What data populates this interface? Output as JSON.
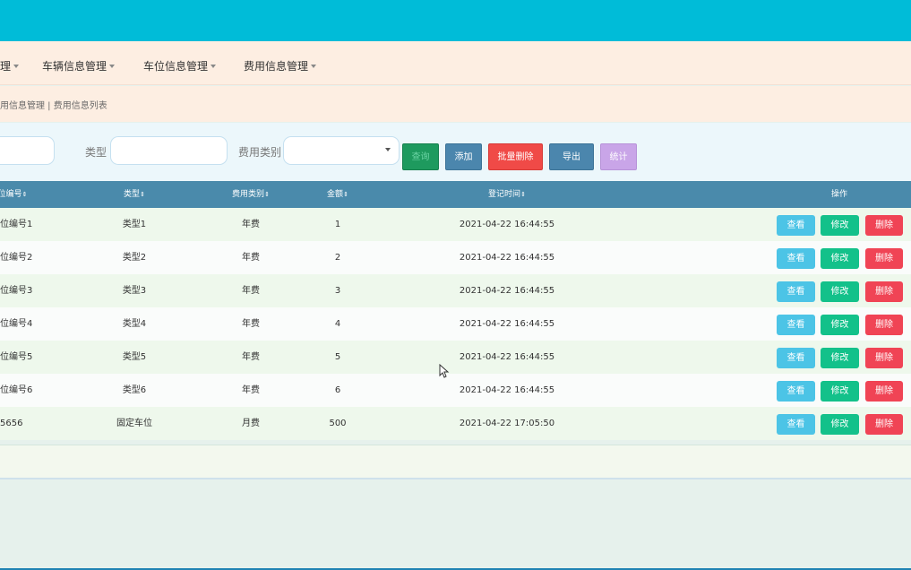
{
  "nav": {
    "items": [
      {
        "label": "理"
      },
      {
        "label": "车辆信息管理"
      },
      {
        "label": "车位信息管理"
      },
      {
        "label": "费用信息管理"
      }
    ]
  },
  "breadcrumb": "用信息管理 | 费用信息列表",
  "search": {
    "type_label": "类型",
    "fee_category_label": "费用类别",
    "buttons": {
      "search": "查询",
      "add": "添加",
      "batch_delete": "批量删除",
      "export": "导出",
      "stats": "统计"
    }
  },
  "table": {
    "headers": {
      "number": "位编号",
      "type": "类型",
      "fee_category": "费用类别",
      "amount": "金额",
      "reg_time": "登记时间",
      "actions": "操作"
    },
    "rows": [
      {
        "number": "位编号1",
        "type": "类型1",
        "fee_category": "年费",
        "amount": "1",
        "reg_time": "2021-04-22 16:44:55"
      },
      {
        "number": "位编号2",
        "type": "类型2",
        "fee_category": "年费",
        "amount": "2",
        "reg_time": "2021-04-22 16:44:55"
      },
      {
        "number": "位编号3",
        "type": "类型3",
        "fee_category": "年费",
        "amount": "3",
        "reg_time": "2021-04-22 16:44:55"
      },
      {
        "number": "位编号4",
        "type": "类型4",
        "fee_category": "年费",
        "amount": "4",
        "reg_time": "2021-04-22 16:44:55"
      },
      {
        "number": "位编号5",
        "type": "类型5",
        "fee_category": "年费",
        "amount": "5",
        "reg_time": "2021-04-22 16:44:55"
      },
      {
        "number": "位编号6",
        "type": "类型6",
        "fee_category": "年费",
        "amount": "6",
        "reg_time": "2021-04-22 16:44:55"
      },
      {
        "number": "5656",
        "type": "固定车位",
        "fee_category": "月费",
        "amount": "500",
        "reg_time": "2021-04-22 17:05:50"
      }
    ],
    "row_actions": {
      "view": "查看",
      "edit": "修改",
      "delete": "删除"
    }
  },
  "colors": {
    "topbar": "#00bcd8",
    "nav_bg": "#fdeee2",
    "header_bg": "#4a8aab",
    "view_btn": "#4cc4e6",
    "edit_btn": "#13c18a",
    "delete_btn": "#f04455"
  }
}
